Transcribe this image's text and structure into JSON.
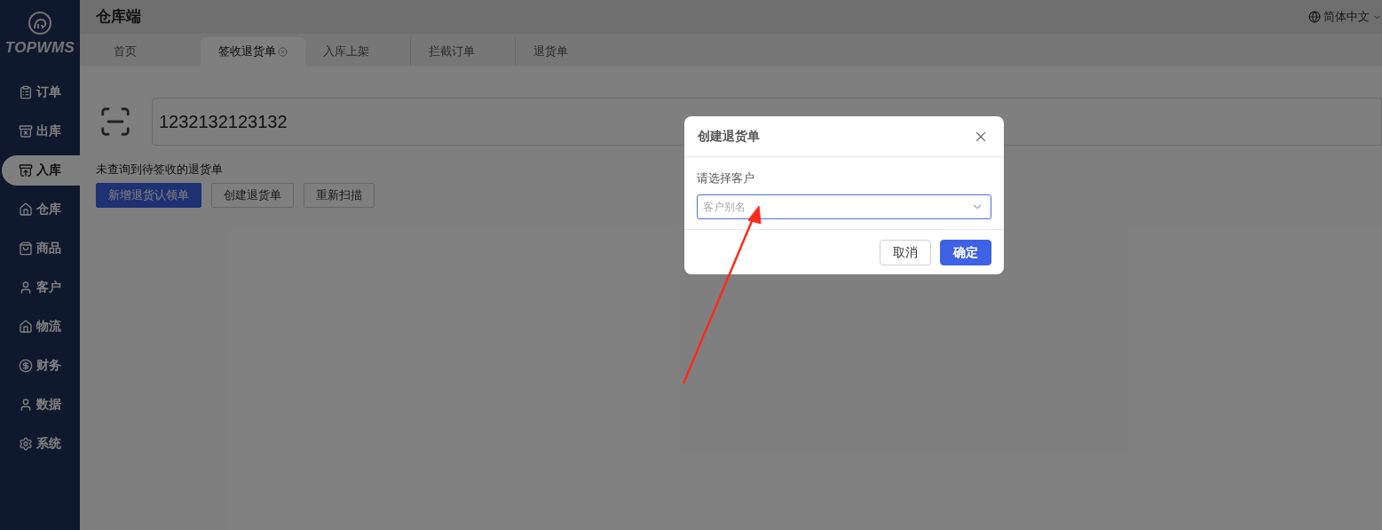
{
  "sidebar": {
    "logo_text": "TOPWMS",
    "items": [
      {
        "label": "订单",
        "selected": false
      },
      {
        "label": "出库",
        "selected": false
      },
      {
        "label": "入库",
        "selected": true
      },
      {
        "label": "仓库",
        "selected": false
      },
      {
        "label": "商品",
        "selected": false
      },
      {
        "label": "客户",
        "selected": false
      },
      {
        "label": "物流",
        "selected": false
      },
      {
        "label": "财务",
        "selected": false
      },
      {
        "label": "数据",
        "selected": false
      },
      {
        "label": "系统",
        "selected": false
      }
    ]
  },
  "header": {
    "title": "仓库端",
    "language": "简体中文"
  },
  "tabs": [
    {
      "label": "首页",
      "selected": false,
      "closable": false
    },
    {
      "label": "签收退货单",
      "selected": true,
      "closable": true
    },
    {
      "label": "入库上架",
      "selected": false,
      "closable": false
    },
    {
      "label": "拦截订单",
      "selected": false,
      "closable": false
    },
    {
      "label": "退货单",
      "selected": false,
      "closable": false
    }
  ],
  "scan": {
    "value": "1232132123132"
  },
  "message": "未查询到待签收的退货单",
  "actions": [
    {
      "label": "新增退货认领单",
      "kind": "primary"
    },
    {
      "label": "创建退货单",
      "kind": "default"
    },
    {
      "label": "重新扫描",
      "kind": "default"
    }
  ],
  "dialog": {
    "title": "创建退货单",
    "field_label": "请选择客户",
    "placeholder": "客户别名",
    "buttons": [
      {
        "label": "取消",
        "kind": "default"
      },
      {
        "label": "确定",
        "kind": "primary"
      }
    ]
  }
}
